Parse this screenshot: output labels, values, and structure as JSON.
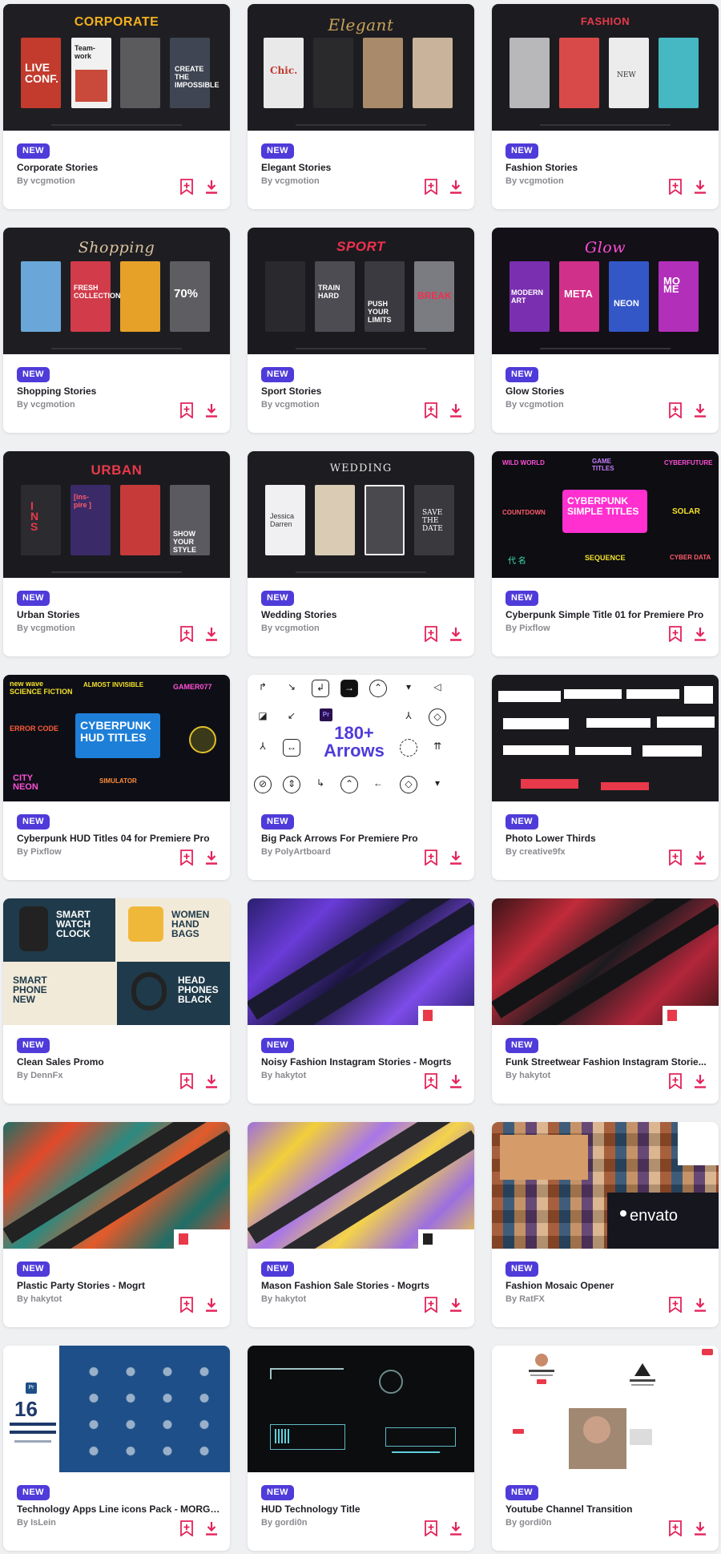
{
  "colors": {
    "badge": "#4f3bd9",
    "action": "#e3235b",
    "title": "#1e1e24",
    "author": "#8a8a90"
  },
  "cards": [
    {
      "badge": "NEW",
      "title": "Corporate Stories",
      "author": "By vcgmotion",
      "thumb_text": "CORPORATE"
    },
    {
      "badge": "NEW",
      "title": "Elegant Stories",
      "author": "By vcgmotion",
      "thumb_text": "Elegant"
    },
    {
      "badge": "NEW",
      "title": "Fashion Stories",
      "author": "By vcgmotion",
      "thumb_text": "FASHION"
    },
    {
      "badge": "NEW",
      "title": "Shopping Stories",
      "author": "By vcgmotion",
      "thumb_text": "Shopping"
    },
    {
      "badge": "NEW",
      "title": "Sport Stories",
      "author": "By vcgmotion",
      "thumb_text": "SPORT"
    },
    {
      "badge": "NEW",
      "title": "Glow Stories",
      "author": "By vcgmotion",
      "thumb_text": "Glow"
    },
    {
      "badge": "NEW",
      "title": "Urban Stories",
      "author": "By vcgmotion",
      "thumb_text": "URBAN"
    },
    {
      "badge": "NEW",
      "title": "Wedding Stories",
      "author": "By vcgmotion",
      "thumb_text": "WEDDING"
    },
    {
      "badge": "NEW",
      "title": "Cyberpunk Simple Title 01 for Premiere Pro",
      "author": "By Pixflow",
      "thumb_text": "CYBERPUNK SIMPLE TITLES"
    },
    {
      "badge": "NEW",
      "title": "Cyberpunk HUD Titles 04 for Premiere Pro",
      "author": "By Pixflow",
      "thumb_text": "CYBERPUNK HUD TITLES"
    },
    {
      "badge": "NEW",
      "title": "Big Pack Arrows For Premiere Pro",
      "author": "By PolyArtboard",
      "thumb_text": "180+ Arrows"
    },
    {
      "badge": "NEW",
      "title": "Photo Lower Thirds",
      "author": "By creative9fx",
      "thumb_text": ""
    },
    {
      "badge": "NEW",
      "title": "Clean Sales Promo",
      "author": "By DennFx",
      "thumb_text": ""
    },
    {
      "badge": "NEW",
      "title": "Noisy Fashion Instagram Stories - Mogrts",
      "author": "By hakytot",
      "thumb_text": ""
    },
    {
      "badge": "NEW",
      "title": "Funk Streetwear Fashion Instagram Storie...",
      "author": "By hakytot",
      "thumb_text": ""
    },
    {
      "badge": "NEW",
      "title": "Plastic Party Stories - Mogrt",
      "author": "By hakytot",
      "thumb_text": ""
    },
    {
      "badge": "NEW",
      "title": "Mason Fashion Sale Stories - Mogrts",
      "author": "By hakytot",
      "thumb_text": ""
    },
    {
      "badge": "NEW",
      "title": "Fashion Mosaic Opener",
      "author": "By RatFX",
      "thumb_text": "envato"
    },
    {
      "badge": "NEW",
      "title": "Technology Apps Line icons Pack - MORGRT",
      "author": "By IsLein",
      "thumb_text": "16"
    },
    {
      "badge": "NEW",
      "title": "HUD Technology Title",
      "author": "By gordi0n",
      "thumb_text": ""
    },
    {
      "badge": "NEW",
      "title": "Youtube Channel Transition",
      "author": "By gordi0n",
      "thumb_text": ""
    }
  ]
}
